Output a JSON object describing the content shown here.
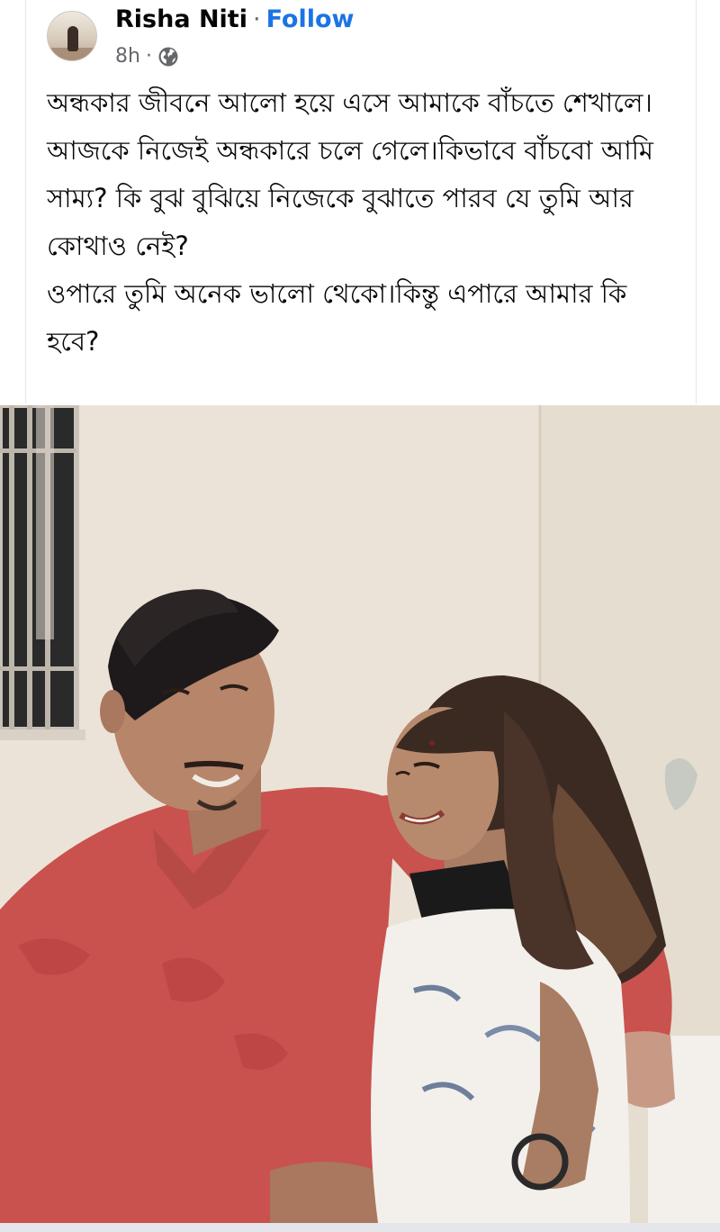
{
  "post": {
    "author": "Risha Niti",
    "separator": "·",
    "follow_label": "Follow",
    "timestamp": "8h",
    "meta_separator": "·",
    "privacy_icon": "globe-icon",
    "paragraphs": [
      "অন্ধকার জীবনে আলো হয়ে এসে আমাকে বাঁচতে শেখালে।আজকে নিজেই অন্ধকারে চলে গেলে।কিভাবে বাঁচবো আমি সাম্য? কি বুঝ বুঝিয়ে নিজেকে বুঝাতে পারব যে তুমি আর কোথাও নেই?",
      "ওপারে তুমি অনেক ভালো থেকো।কিন্তু এপারে আমার কি হবে?"
    ]
  },
  "colors": {
    "follow": "#1b74e4",
    "meta_text": "#65676b",
    "body_text": "#050505"
  }
}
